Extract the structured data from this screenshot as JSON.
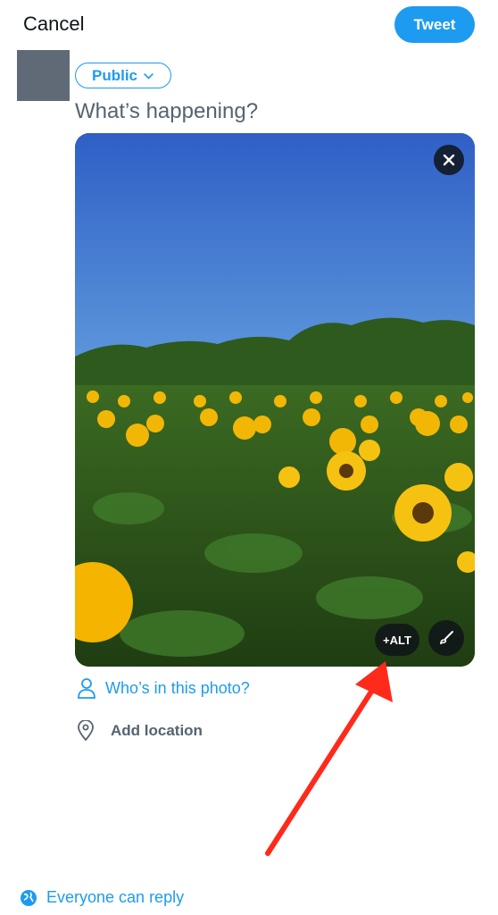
{
  "header": {
    "cancel_label": "Cancel",
    "tweet_label": "Tweet"
  },
  "composer": {
    "audience_label": "Public",
    "placeholder": "What’s happening?"
  },
  "media": {
    "description": "Photo of a sunflower field under a blue sky",
    "alt_label": "+ALT",
    "icons": [
      "close-icon",
      "paintbrush-icon"
    ]
  },
  "actions": {
    "tag_people_label": "Who’s in this photo?",
    "add_location_label": "Add location"
  },
  "footer": {
    "reply_setting_label": "Everyone can reply"
  },
  "colors": {
    "accent": "#1d9bf0",
    "annotation_arrow": "#ff2a1a"
  }
}
